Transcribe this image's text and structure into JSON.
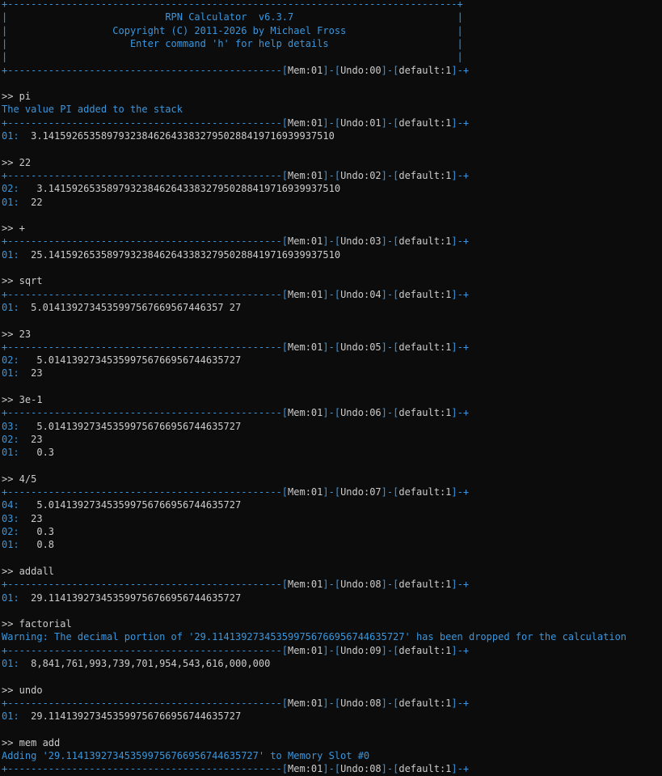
{
  "banner": {
    "top": "+-----------------------------------------------------------------------------+",
    "side": "|",
    "title": "RPN Calculator  v6.3.7",
    "copyright": "Copyright (C) 2011-2026 by Michael Fross",
    "help": "Enter command 'h' for help details",
    "border_prefix": "+-----------------------------------------------"
  },
  "entries": [
    {
      "command": ">> pi",
      "messages": [
        "The value PI added to the stack"
      ],
      "border_prefix": "+-----------------------------------------------",
      "mem": "01",
      "undo": "01",
      "stack_name": "default",
      "stack_num": "1",
      "stack": [
        {
          "slot": "01:",
          "value": "  3.14159265358979323846264338327950288419716939937510"
        }
      ]
    },
    {
      "command": ">> 22",
      "messages": [],
      "border_prefix": "+-----------------------------------------------",
      "mem": "01",
      "undo": "02",
      "stack_name": "default",
      "stack_num": "1",
      "stack": [
        {
          "slot": "02:",
          "value": "   3.14159265358979323846264338327950288419716939937510"
        },
        {
          "slot": "01:",
          "value": "  22"
        }
      ]
    },
    {
      "command": ">> +",
      "messages": [],
      "border_prefix": "+-----------------------------------------------",
      "mem": "01",
      "undo": "03",
      "stack_name": "default",
      "stack_num": "1",
      "stack": [
        {
          "slot": "01:",
          "value": "  25.14159265358979323846264338327950288419716939937510"
        }
      ]
    },
    {
      "command": ">> sqrt",
      "messages": [],
      "border_prefix": "+-----------------------------------------------",
      "mem": "01",
      "undo": "04",
      "stack_name": "default",
      "stack_num": "1",
      "stack": [
        {
          "slot": "01:",
          "value": "  5.0141392734535997567669567446357 27"
        }
      ]
    },
    {
      "command": ">> 23",
      "messages": [],
      "border_prefix": "+-----------------------------------------------",
      "mem": "01",
      "undo": "05",
      "stack_name": "default",
      "stack_num": "1",
      "stack": [
        {
          "slot": "02:",
          "value": "   5.014139273453599756766956744635727"
        },
        {
          "slot": "01:",
          "value": "  23"
        }
      ]
    },
    {
      "command": ">> 3e-1",
      "messages": [],
      "border_prefix": "+-----------------------------------------------",
      "mem": "01",
      "undo": "06",
      "stack_name": "default",
      "stack_num": "1",
      "stack": [
        {
          "slot": "03:",
          "value": "   5.014139273453599756766956744635727"
        },
        {
          "slot": "02:",
          "value": "  23"
        },
        {
          "slot": "01:",
          "value": "   0.3"
        }
      ]
    },
    {
      "command": ">> 4/5",
      "messages": [],
      "border_prefix": "+-----------------------------------------------",
      "mem": "01",
      "undo": "07",
      "stack_name": "default",
      "stack_num": "1",
      "stack": [
        {
          "slot": "04:",
          "value": "   5.014139273453599756766956744635727"
        },
        {
          "slot": "03:",
          "value": "  23"
        },
        {
          "slot": "02:",
          "value": "   0.3"
        },
        {
          "slot": "01:",
          "value": "   0.8"
        }
      ]
    },
    {
      "command": ">> addall",
      "messages": [],
      "border_prefix": "+-----------------------------------------------",
      "mem": "01",
      "undo": "08",
      "stack_name": "default",
      "stack_num": "1",
      "stack": [
        {
          "slot": "01:",
          "value": "  29.114139273453599756766956744635727"
        }
      ]
    },
    {
      "command": ">> factorial",
      "messages": [
        "Warning: The decimal portion of '29.114139273453599756766956744635727' has been dropped for the calculation"
      ],
      "border_prefix": "+-----------------------------------------------",
      "mem": "01",
      "undo": "09",
      "stack_name": "default",
      "stack_num": "1",
      "stack": [
        {
          "slot": "01:",
          "value": "  8,841,761,993,739,701,954,543,616,000,000"
        }
      ]
    },
    {
      "command": ">> undo",
      "messages": [],
      "border_prefix": "+-----------------------------------------------",
      "mem": "01",
      "undo": "08",
      "stack_name": "default",
      "stack_num": "1",
      "stack": [
        {
          "slot": "01:",
          "value": "  29.114139273453599756766956744635727"
        }
      ]
    },
    {
      "command": ">> mem add",
      "messages": [
        "Adding '29.114139273453599756766956744635727' to Memory Slot #0"
      ],
      "border_prefix": "+-----------------------------------------------",
      "mem": "01",
      "undo": "08",
      "stack_name": "default",
      "stack_num": "1",
      "stack": []
    }
  ]
}
